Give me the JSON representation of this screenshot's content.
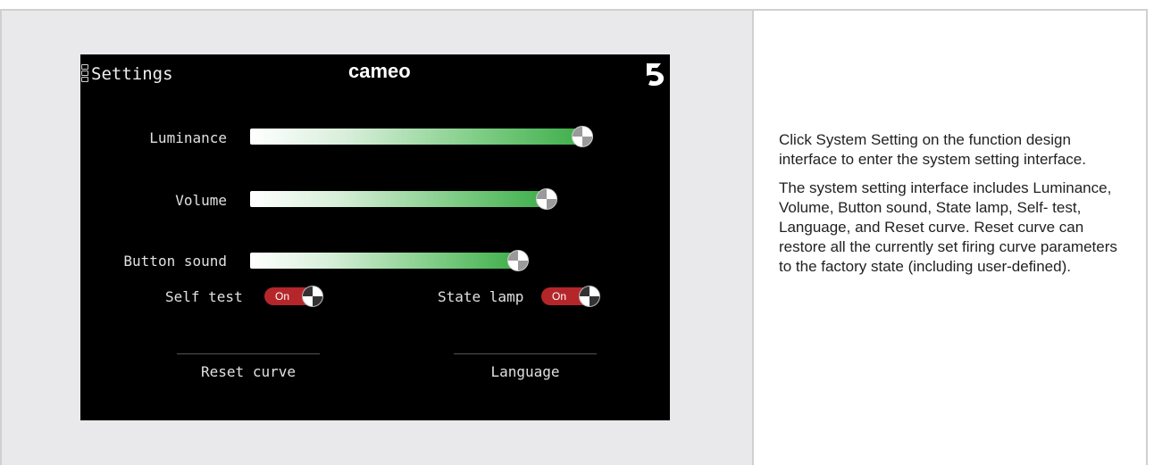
{
  "screen": {
    "title": "Settings",
    "brand": "cameo",
    "sliders": [
      {
        "label": "Luminance",
        "level": 0.93
      },
      {
        "label": "Volume",
        "level": 0.83
      },
      {
        "label": "Button sound",
        "level": 0.75
      }
    ],
    "toggles": [
      {
        "label": "Self test",
        "state": "On"
      },
      {
        "label": "State lamp",
        "state": "On"
      }
    ],
    "buttons": {
      "reset": "Reset curve",
      "language": "Language"
    }
  },
  "description": {
    "para1": "Click System Setting on the function design interface to enter the system setting interface.",
    "para2": "The system setting interface includes Luminance, Volume, Button sound, State lamp, Self- test, Language, and Reset curve. Reset curve can restore all the currently set firing curve parameters to the factory state (including user-defined)."
  },
  "colors": {
    "toggle_on": "#b5262a",
    "slider_fill": "#3fae4a",
    "screen_bg": "#000000"
  }
}
